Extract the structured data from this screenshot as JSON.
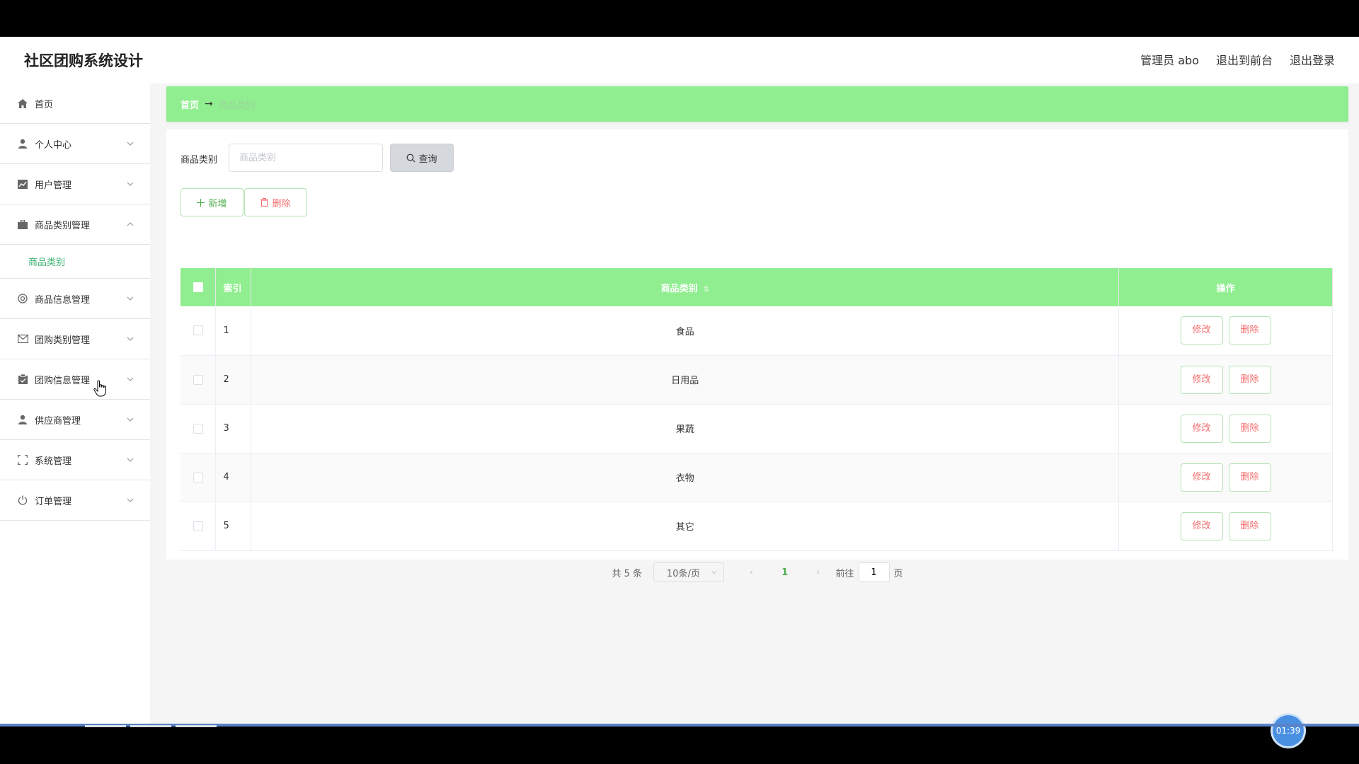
{
  "header": {
    "title": "社区团购系统设计",
    "admin_label": "管理员 abo",
    "back_to_front": "退出到前台",
    "logout": "退出登录"
  },
  "sidebar": {
    "items": [
      {
        "label": "首页",
        "icon": "home-icon"
      },
      {
        "label": "个人中心",
        "icon": "user-icon"
      },
      {
        "label": "用户管理",
        "icon": "chart-icon"
      },
      {
        "label": "商品类别管理",
        "icon": "briefcase-icon",
        "sub": "商品类别"
      },
      {
        "label": "商品信息管理",
        "icon": "gear-circle-icon"
      },
      {
        "label": "团购类别管理",
        "icon": "mail-icon"
      },
      {
        "label": "团购信息管理",
        "icon": "clipboard-icon"
      },
      {
        "label": "供应商管理",
        "icon": "user-icon"
      },
      {
        "label": "系统管理",
        "icon": "expand-icon"
      },
      {
        "label": "订单管理",
        "icon": "power-icon"
      }
    ]
  },
  "breadcrumb": {
    "home": "首页",
    "arrow": "→",
    "current": "商品类别"
  },
  "search": {
    "label": "商品类别",
    "placeholder": "商品类别",
    "button": "查询"
  },
  "actions": {
    "add": "新增",
    "delete": "删除"
  },
  "table": {
    "columns": [
      "索引",
      "商品类别",
      "操作"
    ],
    "rows": [
      {
        "index": "1",
        "category": "食品"
      },
      {
        "index": "2",
        "category": "日用品"
      },
      {
        "index": "3",
        "category": "果蔬"
      },
      {
        "index": "4",
        "category": "衣物"
      },
      {
        "index": "5",
        "category": "其它"
      }
    ],
    "edit_label": "修改",
    "delete_label": "删除"
  },
  "pagination": {
    "total": "共 5 条",
    "page_size": "10条/页",
    "current_page": "1",
    "goto_label": "前往",
    "goto_value": "1",
    "page_suffix": "页"
  },
  "timer": "01:39",
  "colors": {
    "accent_green": "#90ee90",
    "danger_red": "#f56c6c",
    "link_green": "#3cb371"
  }
}
